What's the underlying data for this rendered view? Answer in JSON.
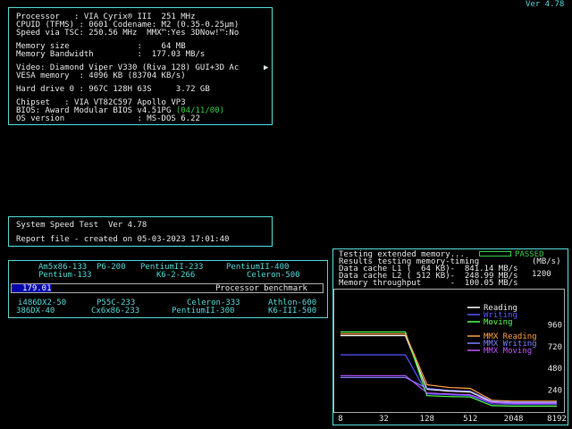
{
  "version": "Ver 4.78",
  "sysinfo": {
    "lines": [
      "Processor   : VIA Cyrix® III  251 MHz",
      "CPUID (TFMS) : 0601 Codename: M2 (0.35-0.25µm)",
      "Speed via TSC: 250.56 MHz  MMX™:Yes 3DNow!™:No",
      "Memory size              :    64 MB",
      "Memory Bandwidth         :  177.03 MB/s",
      "Video: Diamond Viper V330 (Riva 128) GUI+3D Ac",
      "VESA memory  : 4096 KB (83704 KB/s)",
      "Hard drive 0 : 967C 128H 63S     3.72 GB",
      "Chipset   : VIA VT82C597 Apollo VP3",
      "BIOS: Award Modular BIOS v4.51PG",
      "OS version               : MS-DOS 6.22"
    ],
    "bios_date": "(04/11/00)"
  },
  "speedtest": {
    "title": "System Speed Test  Ver 4.78",
    "report": "Report file - created on 05-03-2023 17:01:40"
  },
  "benchmark": {
    "top1": [
      "Am5x86-133",
      "P6-200",
      "PentiumII-233",
      "PentiumII-400"
    ],
    "top2": [
      "Pentium-133",
      "K6-2-266",
      "Celeron-500"
    ],
    "value": "179.01",
    "label": "Processor benchmark",
    "fill_fraction": 0.13,
    "bot1": [
      "i486DX2-50",
      "P55C-233",
      "Celeron-333",
      "Athlon-600"
    ],
    "bot2": [
      "386DX-40",
      "Cx6x86-233",
      "PentiumII-300",
      "K6-III-500"
    ]
  },
  "memtest": {
    "header": "Testing extended memory...",
    "status": "PASSED",
    "unit": "(MB/s)",
    "results_label": "Results testing memory-timing",
    "rows": [
      "Data cache L1 (  64 KB)-  841.14 MB/s",
      "Data cache L2 ( 512 KB)-  248.99 MB/s",
      "Memory throughput      -  100.05 MB/s"
    ],
    "y_ticks": [
      "1200",
      "960",
      "720",
      "480",
      "240"
    ],
    "x_ticks": [
      "8",
      "32",
      "128",
      "512",
      "2048",
      "8192"
    ],
    "legend": [
      "Reading",
      "Writing",
      "Moving",
      "MMX Reading",
      "MMX Writing",
      "MMX Moving"
    ],
    "colors": [
      "#ffffff",
      "#5555ff",
      "#55ff55",
      "#ff9f40",
      "#7f7fff",
      "#bb55ff"
    ]
  },
  "chart_data": {
    "type": "line",
    "xlabel": "",
    "ylabel": "(MB/s)",
    "x": [
      8,
      16,
      32,
      64,
      128,
      256,
      512,
      1024,
      2048,
      4096,
      8192
    ],
    "ylim": [
      0,
      1200
    ],
    "series": [
      {
        "name": "Reading",
        "values": [
          841,
          841,
          841,
          841,
          250,
          230,
          220,
          110,
          100,
          100,
          100
        ]
      },
      {
        "name": "Writing",
        "values": [
          630,
          630,
          630,
          630,
          200,
          190,
          180,
          90,
          85,
          85,
          85
        ]
      },
      {
        "name": "Moving",
        "values": [
          880,
          880,
          880,
          880,
          180,
          170,
          165,
          70,
          65,
          65,
          65
        ]
      },
      {
        "name": "MMX Reading",
        "values": [
          860,
          860,
          860,
          860,
          300,
          270,
          260,
          130,
          120,
          120,
          120
        ]
      },
      {
        "name": "MMX Writing",
        "values": [
          380,
          380,
          380,
          380,
          260,
          240,
          230,
          120,
          110,
          110,
          110
        ]
      },
      {
        "name": "MMX Moving",
        "values": [
          400,
          400,
          400,
          400,
          210,
          200,
          190,
          105,
          95,
          95,
          95
        ]
      }
    ]
  }
}
